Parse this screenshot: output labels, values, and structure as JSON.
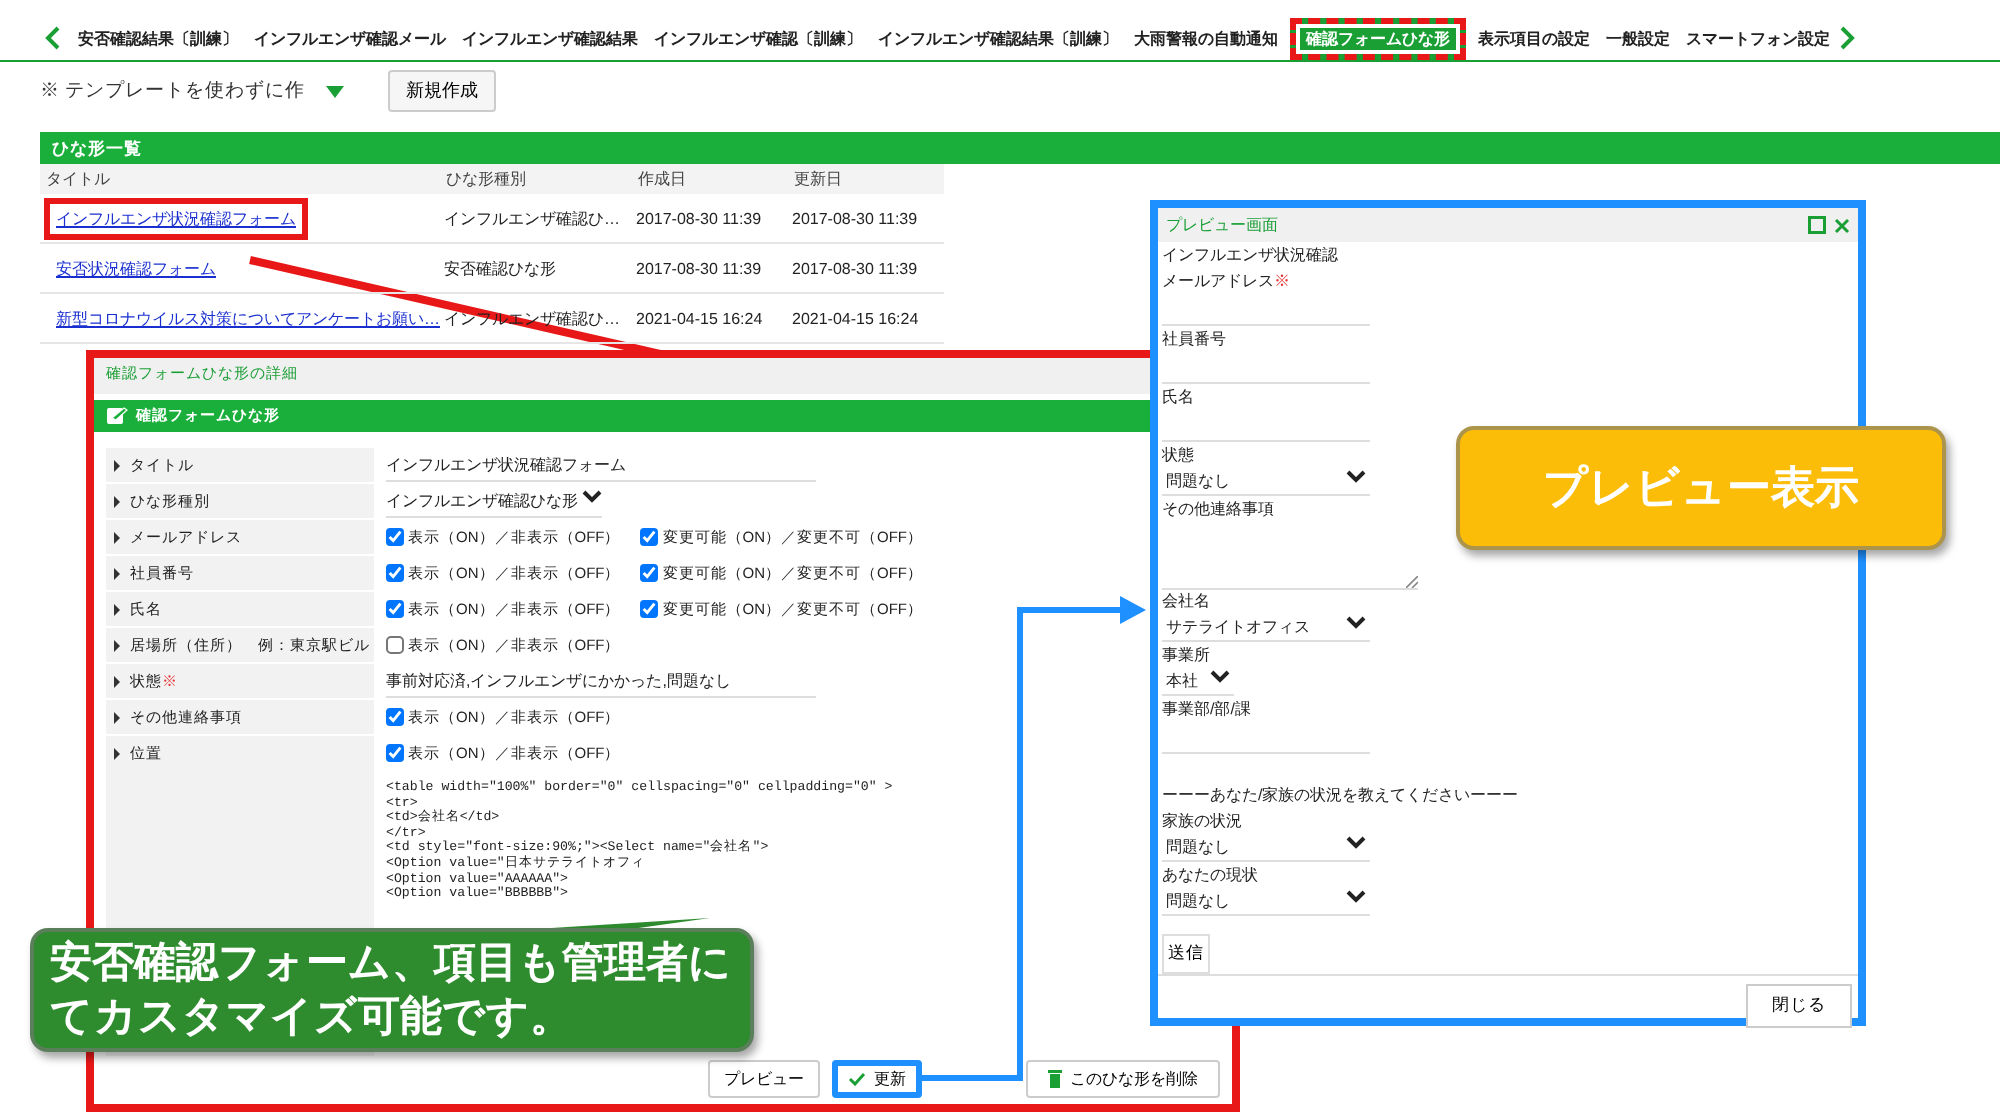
{
  "tabs": [
    {
      "label": "安否確認結果〔訓練〕",
      "selected": false
    },
    {
      "label": "インフルエンザ確認メール",
      "selected": false
    },
    {
      "label": "インフルエンザ確認結果",
      "selected": false
    },
    {
      "label": "インフルエンザ確認〔訓練〕",
      "selected": false
    },
    {
      "label": "インフルエンザ確認結果〔訓練〕",
      "selected": false
    },
    {
      "label": "大雨警報の自動通知",
      "selected": false
    },
    {
      "label": "確認フォームひな形",
      "selected": true
    },
    {
      "label": "表示項目の設定",
      "selected": false
    },
    {
      "label": "一般設定",
      "selected": false
    },
    {
      "label": "スマートフォン設定",
      "selected": false
    }
  ],
  "toolbar": {
    "template_select": "※ テンプレートを使わずに作",
    "new_button": "新規作成"
  },
  "list": {
    "title": "ひな形一覧",
    "columns": [
      "タイトル",
      "ひな形種別",
      "作成日",
      "更新日"
    ],
    "rows": [
      {
        "title": "インフルエンザ状況確認フォーム",
        "type": "インフルエンザ確認ひ…",
        "created": "2017-08-30 11:39",
        "updated": "2017-08-30 11:39",
        "highlighted": true
      },
      {
        "title": "安否状況確認フォーム",
        "type": "安否確認ひな形",
        "created": "2017-08-30 11:39",
        "updated": "2017-08-30 11:39",
        "highlighted": false
      },
      {
        "title": "新型コロナウイルス対策についてアンケートお願い…",
        "type": "インフルエンザ確認ひ…",
        "created": "2021-04-15 16:24",
        "updated": "2021-04-15 16:24",
        "highlighted": false
      }
    ]
  },
  "detail": {
    "window_title": "確認フォームひな形の詳細",
    "header": "確認フォームひな形",
    "rows": [
      {
        "label": "タイトル",
        "kind": "text",
        "value": "インフルエンザ状況確認フォーム"
      },
      {
        "label": "ひな形種別",
        "kind": "select",
        "value": "インフルエンザ確認ひな形"
      },
      {
        "label": "メールアドレス",
        "kind": "checks",
        "checks": [
          {
            "label": "表示（ON）／非表示（OFF）",
            "checked": true
          },
          {
            "label": "変更可能（ON）／変更不可（OFF）",
            "checked": true
          }
        ]
      },
      {
        "label": "社員番号",
        "kind": "checks",
        "checks": [
          {
            "label": "表示（ON）／非表示（OFF）",
            "checked": true
          },
          {
            "label": "変更可能（ON）／変更不可（OFF）",
            "checked": true
          }
        ]
      },
      {
        "label": "氏名",
        "kind": "checks",
        "checks": [
          {
            "label": "表示（ON）／非表示（OFF）",
            "checked": true
          },
          {
            "label": "変更可能（ON）／変更不可（OFF）",
            "checked": true
          }
        ]
      },
      {
        "label": "居場所（住所）　例：東京駅ビル",
        "kind": "checks",
        "checks": [
          {
            "label": "表示（ON）／非表示（OFF）",
            "checked": false
          }
        ]
      },
      {
        "label": "状態",
        "required_mark": "※",
        "kind": "text",
        "value": "事前対応済,インフルエンザにかかった,問題なし"
      },
      {
        "label": "その他連絡事項",
        "kind": "checks",
        "checks": [
          {
            "label": "表示（ON）／非表示（OFF）",
            "checked": true
          }
        ]
      },
      {
        "label": "位置",
        "kind": "checks",
        "checks": [
          {
            "label": "表示（ON）／非表示（OFF）",
            "checked": true
          }
        ]
      }
    ],
    "code_lines": [
      "<table width=\"100%\" border=\"0\" cellspacing=\"0\" cellpadding=\"0\" >",
      "<tr>",
      "<td>会社名</td>",
      "</tr>",
      "<td style=\"font-size:90%;\"><Select name=\"会社名\">",
      "<Option value=\"日本サテライトオフィ",
      "<Option value=\"AAAAAA\">",
      "<Option value=\"BBBBBB\">"
    ],
    "buttons": [
      {
        "label": "プレビュー",
        "kind": "preview",
        "highlighted": false
      },
      {
        "label": "更新",
        "kind": "update",
        "highlighted": true
      },
      {
        "label": "このひな形を削除",
        "kind": "delete",
        "highlighted": false
      }
    ]
  },
  "preview": {
    "title": "プレビュー画面",
    "highlighted": true,
    "items": [
      {
        "kind": "heading",
        "text": "インフルエンザ状況確認"
      },
      {
        "kind": "input",
        "label": "メールアドレス",
        "required_mark": "※"
      },
      {
        "kind": "input",
        "label": "社員番号"
      },
      {
        "kind": "input",
        "label": "氏名"
      },
      {
        "kind": "select",
        "label": "状態",
        "value": "問題なし"
      },
      {
        "kind": "textarea",
        "label": "その他連絡事項"
      },
      {
        "kind": "select",
        "label": "会社名",
        "value": "サテライトオフィス"
      },
      {
        "kind": "select",
        "label": "事業所",
        "value": "本社"
      },
      {
        "kind": "input",
        "label": "事業部/部/課"
      },
      {
        "kind": "heading",
        "text": "ーーーあなた/家族の状況を教えてくださいーーー"
      },
      {
        "kind": "select",
        "label": "家族の状況",
        "value": "問題なし"
      },
      {
        "kind": "select",
        "label": "あなたの現状",
        "value": "問題なし"
      },
      {
        "kind": "button",
        "text": "送信"
      }
    ],
    "close": "閉じる"
  },
  "callouts": [
    {
      "text": "プレビュー表示",
      "color": "#fbbd08"
    },
    {
      "text": "安否確認フォーム、項目も管理者にてカスタマイズ可能です。",
      "color": "#2e8b2e"
    }
  ]
}
